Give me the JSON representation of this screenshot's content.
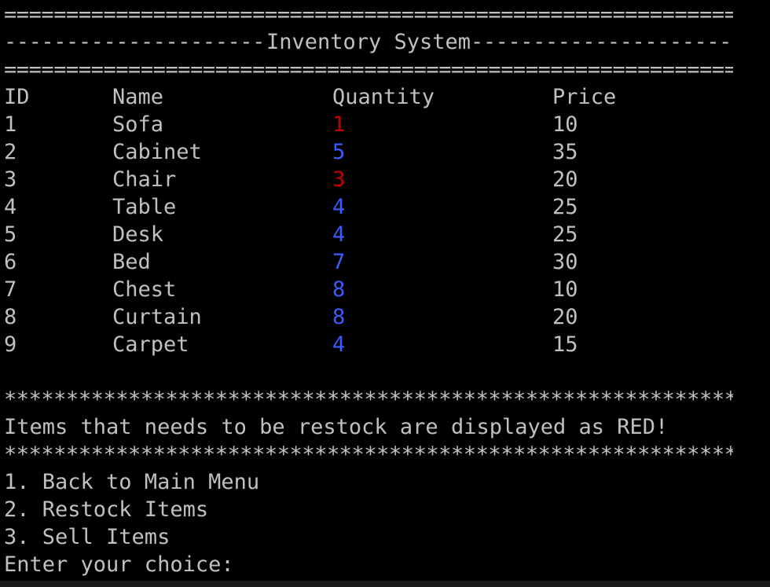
{
  "colors": {
    "background": "#000000",
    "text": "#c0c0c0",
    "restock_red": "#c40000",
    "ok_blue": "#3b5bff"
  },
  "header": {
    "top_separator": "======================================================================",
    "title": "Inventory System",
    "title_dash": "------------------------------------------------------------------------------------------------------------",
    "bottom_separator": "======================================================================"
  },
  "table": {
    "columns": [
      "ID",
      "Name",
      "Quantity",
      "Price"
    ],
    "rows": [
      {
        "id": "1",
        "name": "Sofa",
        "quantity": "1",
        "price": "10",
        "status": "low"
      },
      {
        "id": "2",
        "name": "Cabinet",
        "quantity": "5",
        "price": "35",
        "status": "ok"
      },
      {
        "id": "3",
        "name": "Chair",
        "quantity": "3",
        "price": "20",
        "status": "low"
      },
      {
        "id": "4",
        "name": "Table",
        "quantity": "4",
        "price": "25",
        "status": "ok"
      },
      {
        "id": "5",
        "name": "Desk",
        "quantity": "4",
        "price": "25",
        "status": "ok"
      },
      {
        "id": "6",
        "name": "Bed",
        "quantity": "7",
        "price": "30",
        "status": "ok"
      },
      {
        "id": "7",
        "name": "Chest",
        "quantity": "8",
        "price": "10",
        "status": "ok"
      },
      {
        "id": "8",
        "name": "Curtain",
        "quantity": "8",
        "price": "20",
        "status": "ok"
      },
      {
        "id": "9",
        "name": "Carpet",
        "quantity": "4",
        "price": "15",
        "status": "ok"
      }
    ]
  },
  "notice": {
    "star_separator": "**********************************************************************",
    "message": "Items that needs to be restock are displayed as RED!"
  },
  "menu": {
    "items": [
      "1. Back to Main Menu",
      "2. Restock Items",
      "3. Sell Items"
    ],
    "prompt": "Enter your choice: "
  }
}
